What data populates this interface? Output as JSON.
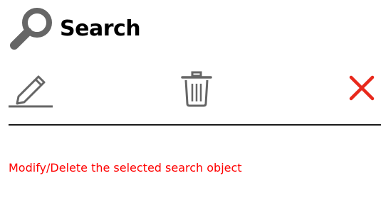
{
  "header": {
    "title": "Search",
    "icon": "search-icon"
  },
  "toolbar": {
    "buttons": [
      {
        "icon": "pencil-icon",
        "action": "edit"
      },
      {
        "icon": "trash-icon",
        "action": "delete"
      },
      {
        "icon": "close-icon",
        "action": "close"
      }
    ]
  },
  "status": {
    "message": "Modify/Delete the selected search object",
    "color": "#ff0000"
  },
  "colors": {
    "icon_gray": "#666666",
    "close_red": "#e8291c",
    "divider": "#1a1a1a"
  }
}
